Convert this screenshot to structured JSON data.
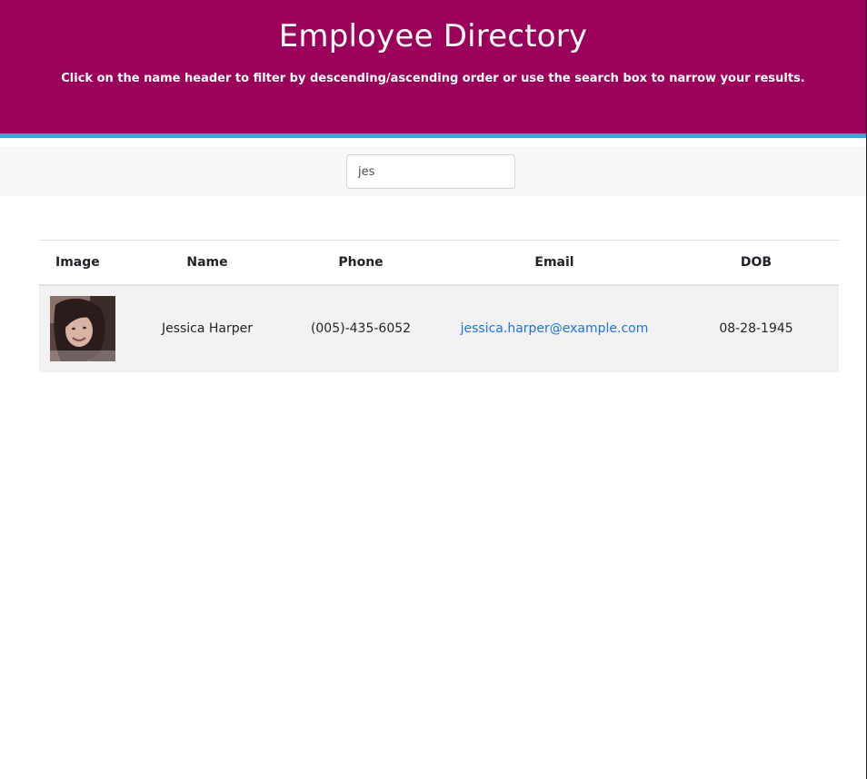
{
  "header": {
    "title": "Employee Directory",
    "subtitle": "Click on the name header to filter by descending/ascending order or use the search box to narrow your results."
  },
  "search": {
    "value": "jes",
    "placeholder": ""
  },
  "table": {
    "columns": [
      "Image",
      "Name",
      "Phone",
      "Email",
      "DOB"
    ],
    "rows": [
      {
        "image": "avatar-photo",
        "name": "Jessica Harper",
        "phone": "(005)-435-6052",
        "email": "jessica.harper@example.com",
        "dob": "08-28-1945"
      }
    ]
  },
  "colors": {
    "header_bg": "#9b005a",
    "stripe": "#29aee0",
    "link": "#1a73e8",
    "row_bg": "#f2f2f2"
  }
}
